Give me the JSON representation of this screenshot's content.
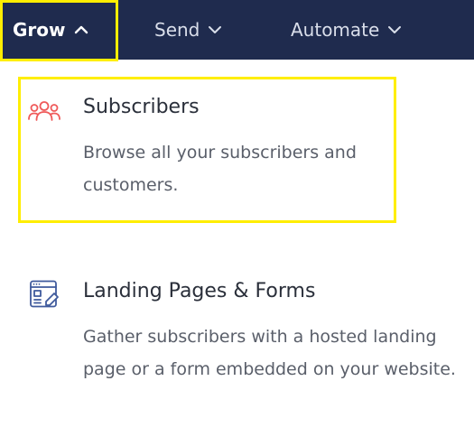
{
  "navbar": {
    "items": [
      {
        "label": "Grow",
        "state": "expanded",
        "icon": "chevron-up-icon"
      },
      {
        "label": "Send",
        "state": "collapsed",
        "icon": "chevron-down-icon"
      },
      {
        "label": "Automate",
        "state": "collapsed",
        "icon": "chevron-down-icon"
      }
    ]
  },
  "dropdown": {
    "entries": [
      {
        "title": "Subscribers",
        "description": "Browse all your subscribers and customers.",
        "icon": "subscribers-group-icon",
        "icon_color": "#ef5a5a"
      },
      {
        "title": "Landing Pages & Forms",
        "description": "Gather subscribers with a hosted landing page or a form embedded on your website.",
        "icon": "landing-page-form-icon",
        "icon_color": "#3f5a9c"
      }
    ]
  },
  "colors": {
    "navbar_bg": "#1f2b4e",
    "highlight": "#ffee00"
  }
}
